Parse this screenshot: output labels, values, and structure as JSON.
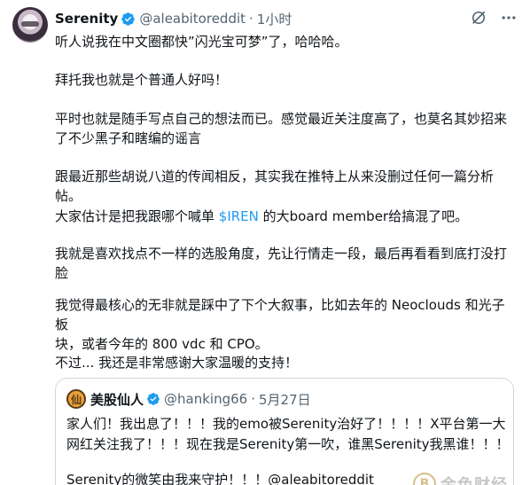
{
  "tweet": {
    "display_name": "Serenity",
    "handle": "@aleabitoreddit",
    "separator": "·",
    "time": "1小时",
    "paragraphs": [
      "听人说我在中文圈都快”闪光宝可梦”了，哈哈哈。",
      "拜托我也就是个普通人好吗！",
      "平时也就是随手写点自己的想法而已。感觉最近关注度高了，也莫名其妙招来\n了不少黑子和瞎编的谣言",
      "跟最近那些胡说八道的传闻相反，其实我在推特上从来没删过任何一篇分析\n帖。",
      "我就是喜欢找点不一样的选股角度，先让行情走一段，最后再看看到底打没打\n脸",
      "我觉得最核心的无非就是踩中了下个大叙事，比如去年的 Neoclouds 和光子板\n块，或者今年的 800 vdc 和 CPO。",
      "不过... 我还是非常感谢大家温暖的支持！"
    ],
    "mention_para": {
      "before": "大家估计是把我跟哪个喊单 ",
      "cashtag": "$IREN",
      "after": " 的大board member给搞混了吧。"
    }
  },
  "quote": {
    "avatar_glyph": "仙",
    "display_name": "美股仙人",
    "handle": "@hanking66",
    "separator": "·",
    "date": "5月27日",
    "lines": [
      "家人们！我出息了！！！我的emo被Serenity治好了！！！！X平台第一大",
      "网红关注我了！！！现在我是Serenity第一吹，谁黑Serenity我黑谁！！！",
      "Serenity的微笑由我来守护！！！@aleabitoreddit"
    ]
  },
  "watermark": {
    "logo_glyph": "B",
    "text": "金色财经"
  },
  "icons": {
    "verified": "verified-badge-icon",
    "grok": "grok-icon",
    "more": "more-icon"
  },
  "colors": {
    "link": "#1d9bf0",
    "verified": "#1d9bf0",
    "muted": "#536471"
  }
}
